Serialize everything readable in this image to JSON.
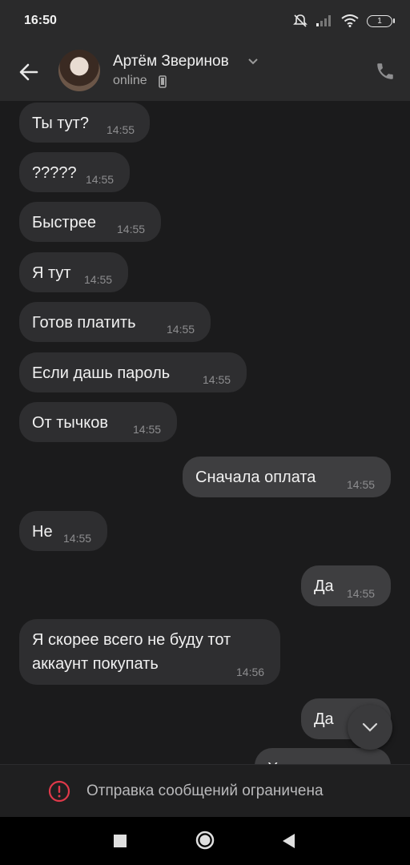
{
  "status_bar": {
    "time": "16:50",
    "battery": "1"
  },
  "header": {
    "contact_name": "Артём Зверинов",
    "status": "online",
    "icons": [
      "back-arrow-icon",
      "chevron-down-icon",
      "phone-icon"
    ]
  },
  "messages": [
    {
      "dir": "in",
      "text": "Ты тут?",
      "time": "14:55"
    },
    {
      "dir": "in",
      "text": "?????",
      "time": "14:55"
    },
    {
      "dir": "in",
      "text": "Быстрее",
      "time": "14:55"
    },
    {
      "dir": "in",
      "text": "Я тут",
      "time": "14:55"
    },
    {
      "dir": "in",
      "text": "Готов платить",
      "time": "14:55"
    },
    {
      "dir": "in",
      "text": "Если дашь пароль",
      "time": "14:55"
    },
    {
      "dir": "in",
      "text": "От тычков",
      "time": "14:55"
    },
    {
      "dir": "out",
      "text": "Сначала оплата",
      "time": "14:55"
    },
    {
      "dir": "in",
      "text": "Не",
      "time": "14:55"
    },
    {
      "dir": "out",
      "text": "Да",
      "time": "14:55"
    },
    {
      "dir": "in",
      "text": "Я скорее всего не буду тот\nаккаунт покупать",
      "time": "14:56"
    },
    {
      "dir": "out",
      "text": "Да",
      "time": ""
    },
    {
      "dir": "out",
      "text": "Х",
      "time": ""
    }
  ],
  "restriction_notice": "Отправка сообщений ограничена",
  "colors": {
    "background": "#1b1b1c",
    "bubble_in": "#2e2e30",
    "bubble_out": "#3e3e40",
    "alert": "#e0394a"
  }
}
